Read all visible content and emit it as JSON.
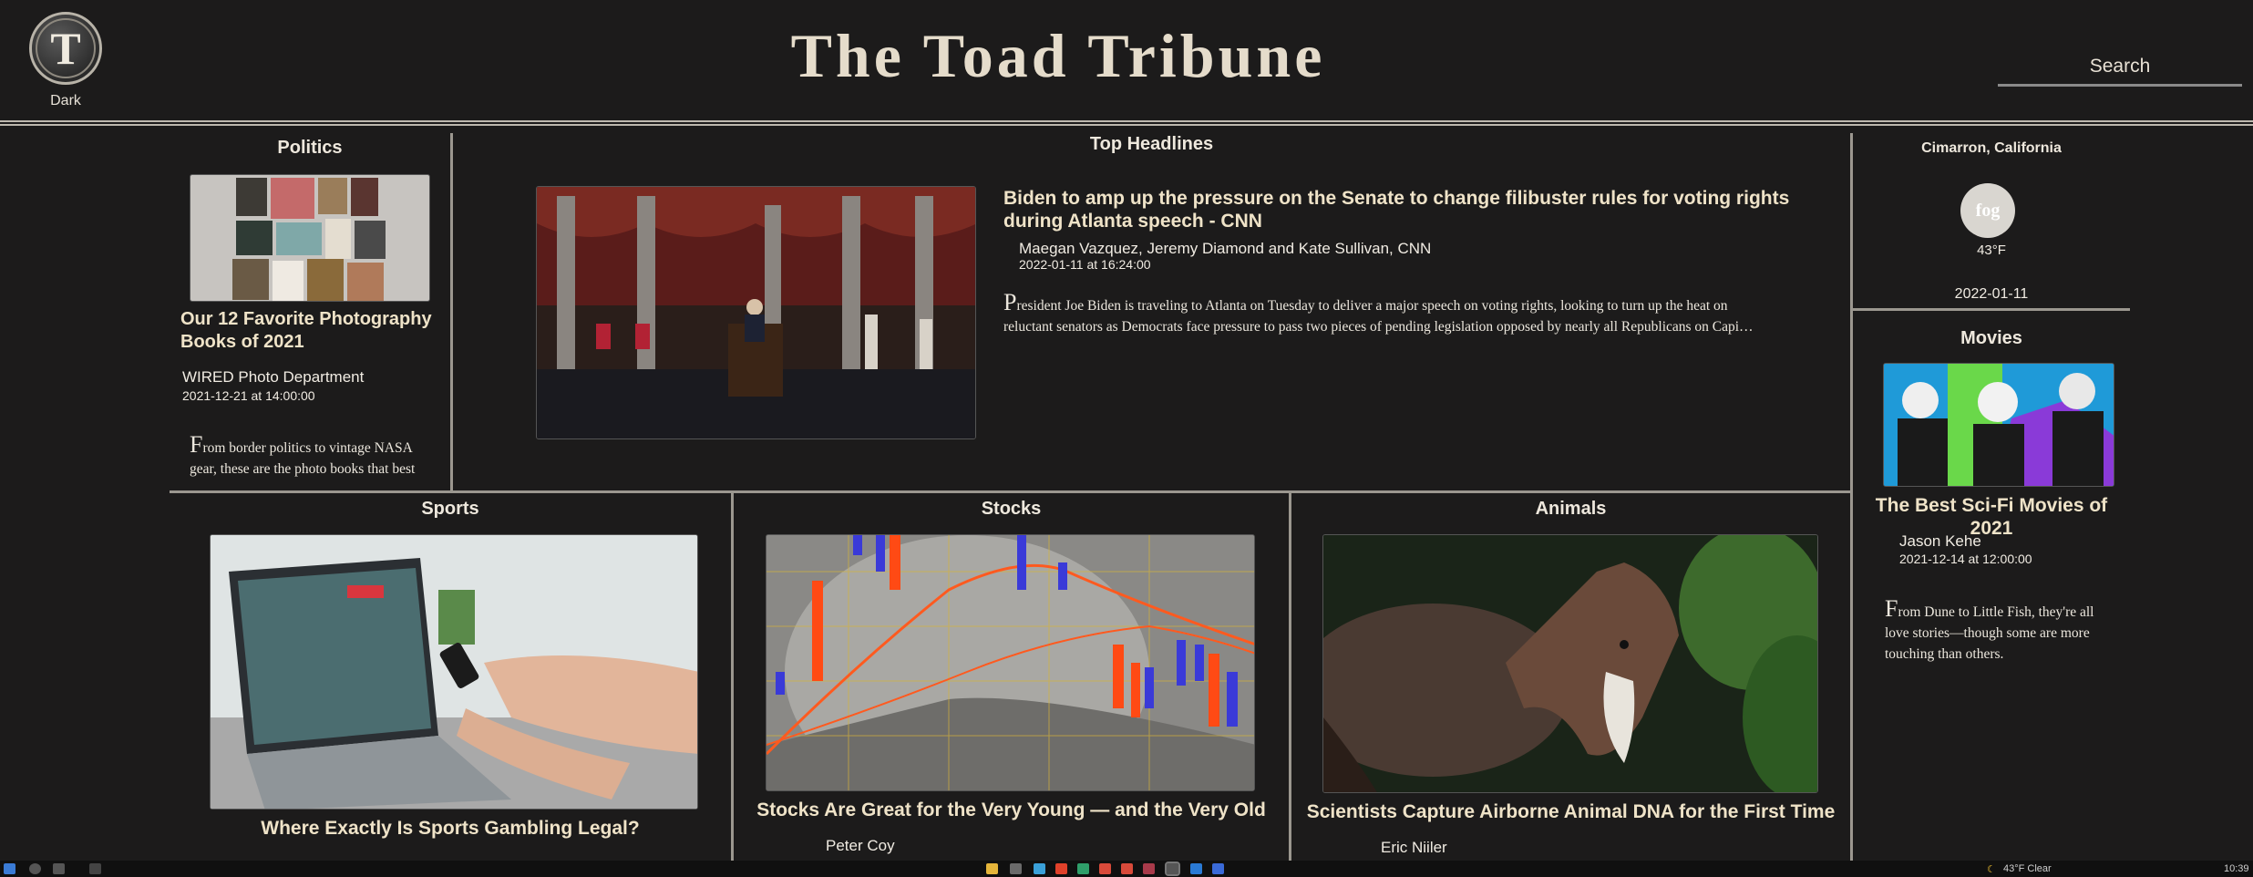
{
  "header": {
    "logo_letter": "T",
    "theme_toggle_label": "Dark",
    "masthead": "The Toad Tribune",
    "search_placeholder": "Search"
  },
  "politics": {
    "section_title": "Politics",
    "article": {
      "title": "Our 12 Favorite Photography Books of 2021",
      "author": "WIRED Photo Department",
      "date": "2021-12-21 at 14:00:00",
      "dropcap": "F",
      "body": "rom border politics to vintage NASA gear, these are the photo books that best"
    }
  },
  "top_headlines": {
    "section_title": "Top Headlines",
    "article": {
      "title": "Biden to amp up the pressure on the Senate to change filibuster rules for voting rights during Atlanta speech - CNN",
      "author": "Maegan Vazquez, Jeremy Diamond and Kate Sullivan, CNN",
      "date": "2022-01-11 at 16:24:00",
      "dropcap": "P",
      "body": "resident Joe Biden is traveling to Atlanta on Tuesday to deliver a major speech on voting rights, looking to turn up the heat on reluctant senators as Democrats face pressure to pass two pieces of pending legislation opposed by nearly all Republicans on Capi…"
    }
  },
  "weather": {
    "location": "Cimarron, California",
    "condition_icon_label": "fog",
    "temperature": "43°F",
    "date": "2022-01-11"
  },
  "movies": {
    "section_title": "Movies",
    "article": {
      "title": "The Best Sci-Fi Movies of 2021",
      "author": "Jason Kehe",
      "date": "2021-12-14 at 12:00:00",
      "dropcap": "F",
      "body": "rom Dune to Little Fish, they're all love stories—though some are more touching than others."
    }
  },
  "sports": {
    "section_title": "Sports",
    "article": {
      "title": "Where Exactly Is Sports Gambling Legal?"
    }
  },
  "stocks": {
    "section_title": "Stocks",
    "article": {
      "title": "Stocks Are Great for the Very Young — and the Very Old",
      "author": "Peter Coy"
    }
  },
  "animals": {
    "section_title": "Animals",
    "article": {
      "title": "Scientists Capture Airborne Animal DNA for the First Time",
      "author": "Eric Niiler"
    }
  },
  "taskbar": {
    "weather": "43°F  Clear",
    "time": "10:39"
  },
  "colors": {
    "background": "#1c1b1b",
    "masthead_text": "#e5dccb",
    "article_title": "#efe3c8",
    "divider": "#9b978f"
  }
}
